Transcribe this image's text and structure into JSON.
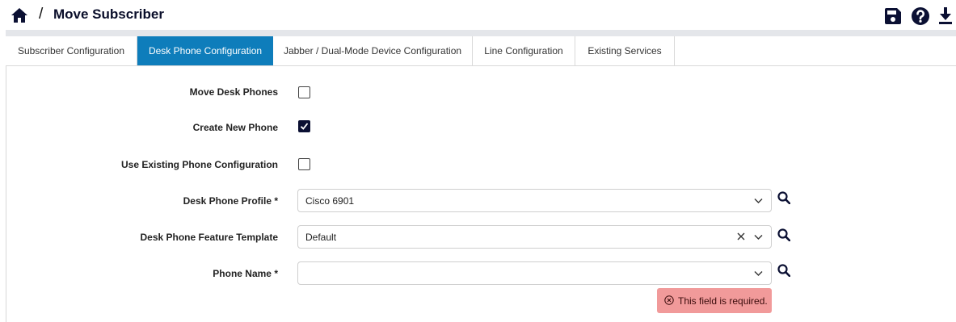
{
  "header": {
    "separator": "/",
    "title": "Move Subscriber",
    "icons": [
      "home-icon",
      "save-icon",
      "help-icon",
      "download-icon"
    ]
  },
  "tabs": [
    {
      "label": "Subscriber Configuration",
      "active": false
    },
    {
      "label": "Desk Phone Configuration",
      "active": true
    },
    {
      "label": "Jabber / Dual-Mode Device Configuration",
      "active": false
    },
    {
      "label": "Line Configuration",
      "active": false
    },
    {
      "label": "Existing Services",
      "active": false
    }
  ],
  "form": {
    "move_desk_phones": {
      "label": "Move Desk Phones",
      "checked": false
    },
    "create_new_phone": {
      "label": "Create New Phone",
      "checked": true
    },
    "use_existing_config": {
      "label": "Use Existing Phone Configuration",
      "checked": false
    },
    "desk_phone_profile": {
      "label": "Desk Phone Profile *",
      "value": "Cisco 6901"
    },
    "feature_template": {
      "label": "Desk Phone Feature Template",
      "value": "Default"
    },
    "phone_name": {
      "label": "Phone Name *",
      "value": "",
      "error": "This field is required."
    }
  },
  "colors": {
    "accent": "#0e7dbb",
    "header_title": "#0a0e2a",
    "checkbox_checked": "#0b1033",
    "error_bg": "#f19a9a",
    "header_bar": "#e4e6ea"
  }
}
